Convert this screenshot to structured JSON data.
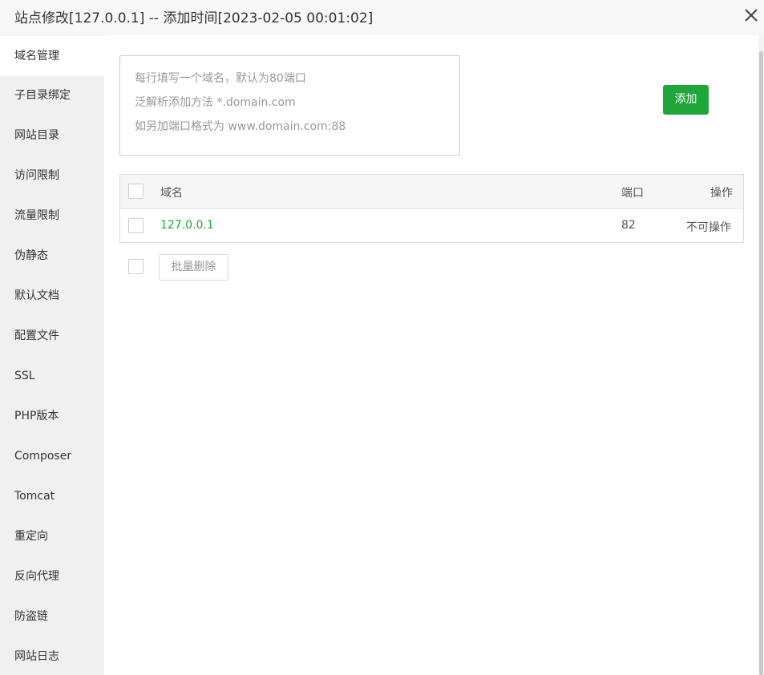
{
  "dialog": {
    "title": "站点修改[127.0.0.1] -- 添加时间[2023-02-05 00:01:02]"
  },
  "sidebar": {
    "items": [
      {
        "label": "域名管理",
        "active": true
      },
      {
        "label": "子目录绑定"
      },
      {
        "label": "网站目录"
      },
      {
        "label": "访问限制"
      },
      {
        "label": "流量限制"
      },
      {
        "label": "伪静态"
      },
      {
        "label": "默认文档"
      },
      {
        "label": "配置文件"
      },
      {
        "label": "SSL"
      },
      {
        "label": "PHP版本"
      },
      {
        "label": "Composer"
      },
      {
        "label": "Tomcat"
      },
      {
        "label": "重定向"
      },
      {
        "label": "反向代理"
      },
      {
        "label": "防盗链"
      },
      {
        "label": "网站日志"
      }
    ]
  },
  "domain_input": {
    "placeholder_lines": [
      "每行填写一个域名，默认为80端口",
      "泛解析添加方法 *.domain.com",
      "如另加端口格式为 www.domain.com:88"
    ]
  },
  "add_button": {
    "label": "添加"
  },
  "table": {
    "headers": {
      "domain": "域名",
      "port": "端口",
      "action": "操作"
    },
    "rows": [
      {
        "domain": "127.0.0.1",
        "port": "82",
        "action": "不可操作"
      }
    ]
  },
  "batch_delete": {
    "label": "批量删除"
  },
  "colors": {
    "accent": "#20a53a",
    "sidebar_bg": "#f0f0f0"
  }
}
